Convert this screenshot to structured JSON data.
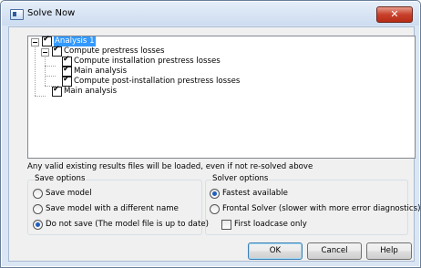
{
  "window": {
    "title": "Solve Now",
    "close_glyph": "✕"
  },
  "tree": [
    {
      "label": "Analysis 1",
      "checked": true,
      "selected": true
    },
    {
      "label": "Compute prestress losses",
      "checked": true
    },
    {
      "label": "Compute installation prestress losses",
      "checked": true
    },
    {
      "label": "Main analysis",
      "checked": true
    },
    {
      "label": "Compute post-installation prestress losses",
      "checked": true
    },
    {
      "label": "Main analysis",
      "checked": true
    }
  ],
  "info_text": "Any valid existing results files will be loaded, even if not re-solved above",
  "save_options": {
    "title": "Save options",
    "items": [
      {
        "label": "Save model",
        "selected": false
      },
      {
        "label": "Save model with a different name",
        "selected": false
      },
      {
        "label": "Do not save (The model file is up to date)",
        "selected": true
      }
    ]
  },
  "solver_options": {
    "title": "Solver options",
    "items": [
      {
        "label": "Fastest available",
        "selected": true
      },
      {
        "label": "Frontal Solver (slower with more error diagnostics)",
        "selected": false
      }
    ],
    "first_loadcase": {
      "label": "First loadcase only",
      "checked": false
    }
  },
  "buttons": {
    "ok": "OK",
    "cancel": "Cancel",
    "help": "Help"
  },
  "colors": {
    "selection": "#3399ff",
    "close_button": "#c7402b",
    "title_bar": "#dbe6f4"
  }
}
